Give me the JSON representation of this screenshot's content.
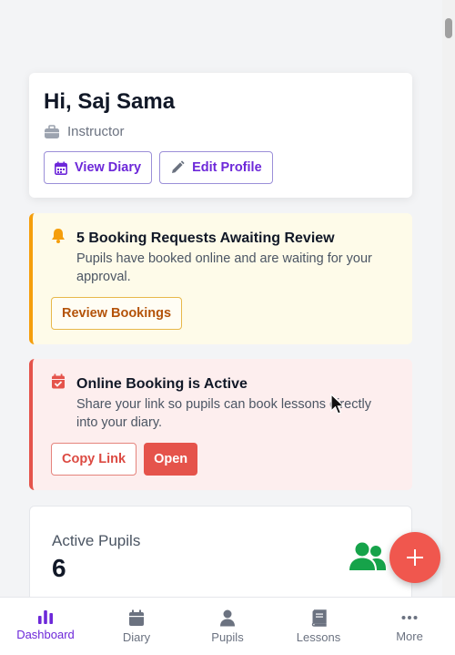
{
  "welcome": {
    "greeting": "Hi, Saj Sama",
    "role": "Instructor",
    "view_diary": "View Diary",
    "edit_profile": "Edit Profile"
  },
  "booking_alert": {
    "title": "5 Booking Requests Awaiting Review",
    "body": "Pupils have booked online and are waiting for your approval.",
    "button": "Review Bookings"
  },
  "online_alert": {
    "title": "Online Booking is Active",
    "body": "Share your link so pupils can book lessons directly into your diary.",
    "copy_button": "Copy Link",
    "open_button": "Open"
  },
  "stats": {
    "label": "Active Pupils",
    "value": "6"
  },
  "nav": {
    "items": [
      {
        "label": "Dashboard",
        "icon": "chart-bar-icon",
        "active": true
      },
      {
        "label": "Diary",
        "icon": "calendar-icon",
        "active": false
      },
      {
        "label": "Pupils",
        "icon": "user-icon",
        "active": false
      },
      {
        "label": "Lessons",
        "icon": "book-icon",
        "active": false
      },
      {
        "label": "More",
        "icon": "ellipsis-icon",
        "active": false
      }
    ]
  },
  "colors": {
    "accent": "#6d28d9",
    "warning": "#f59e0b",
    "danger": "#e5534b",
    "success": "#16a34a"
  }
}
